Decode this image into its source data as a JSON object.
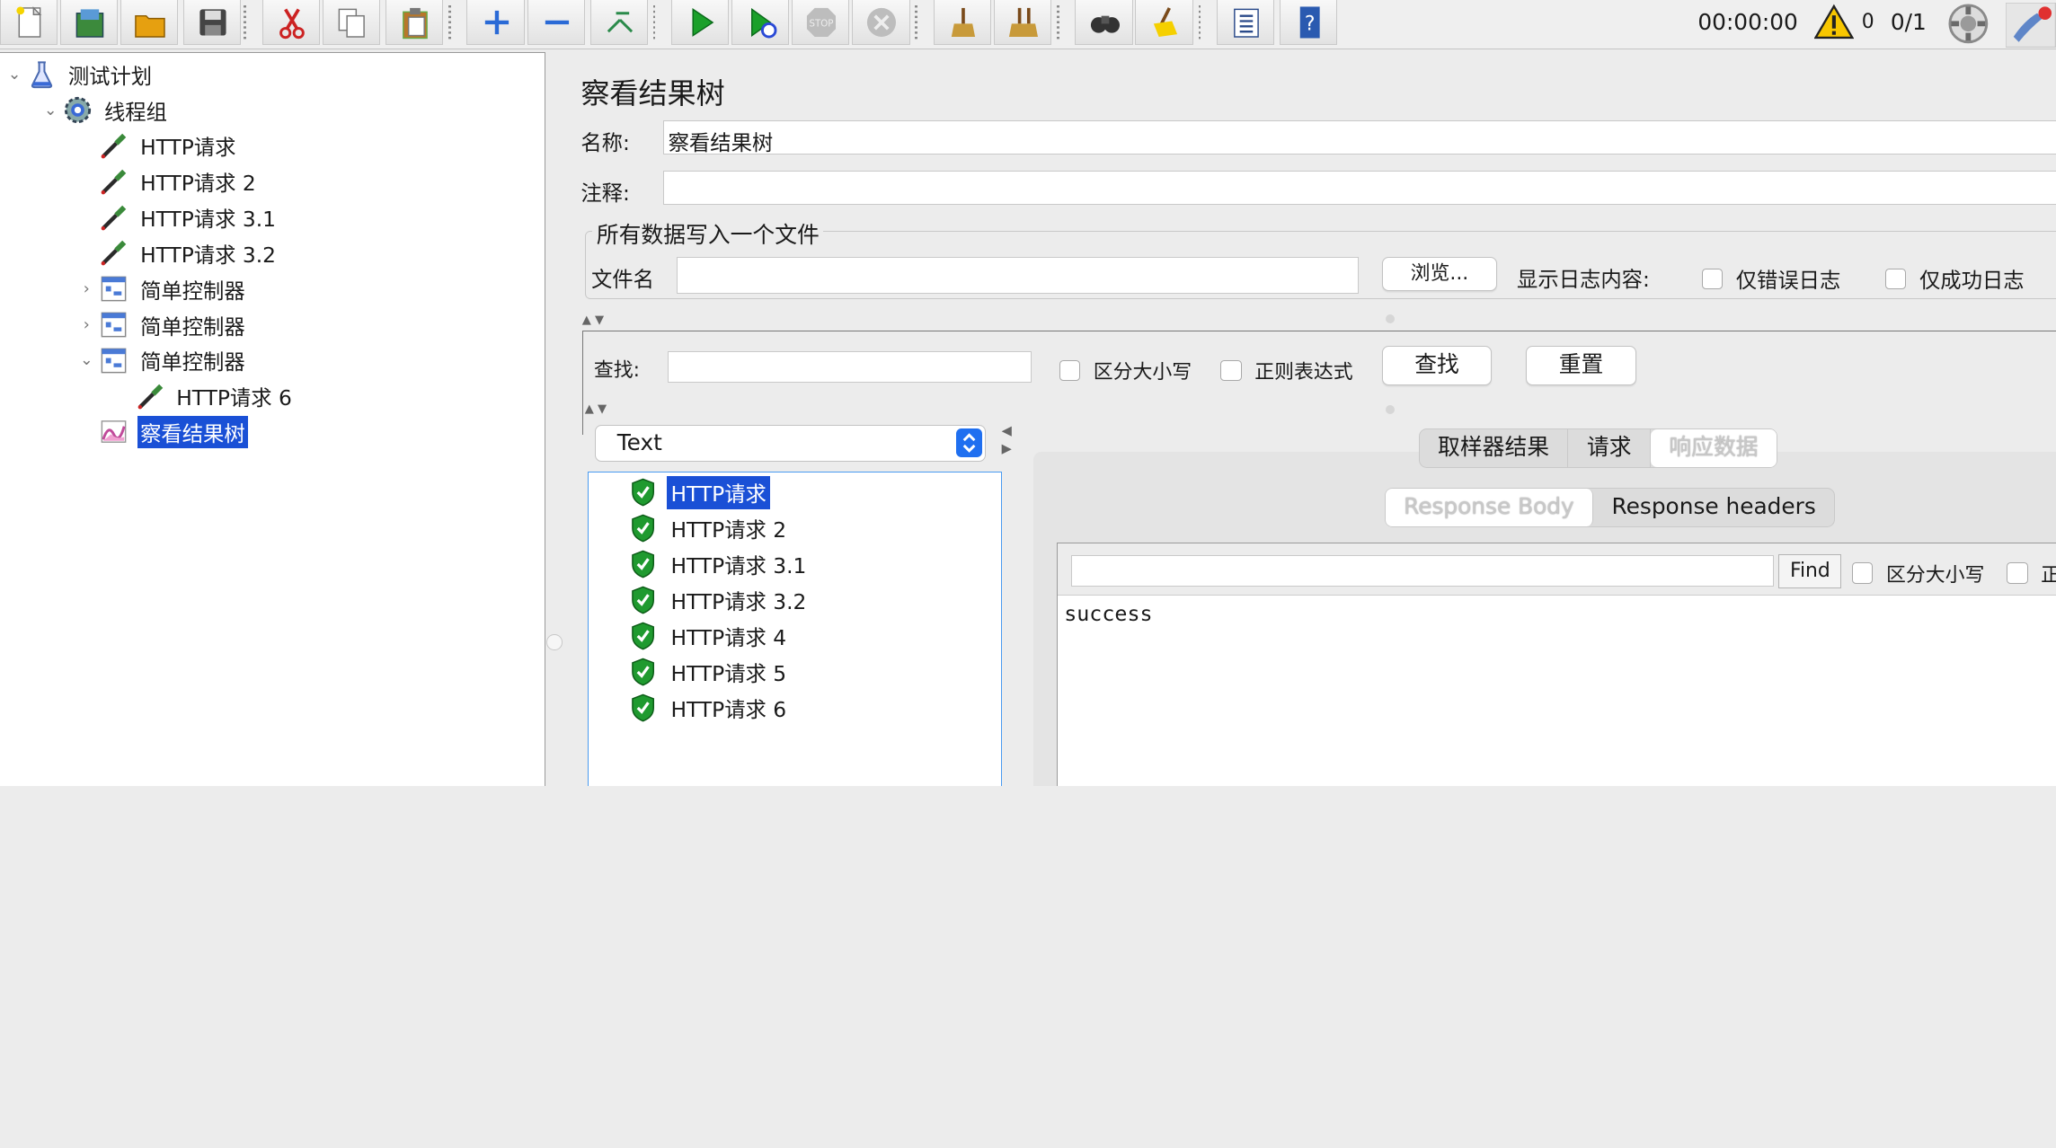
{
  "toolbar": {
    "buttons": [
      "new-icon",
      "templates-icon",
      "open-icon",
      "save-icon",
      "cut-icon",
      "copy-icon",
      "paste-icon",
      "expand-icon",
      "collapse-icon",
      "toggle-icon",
      "start-icon",
      "start-no-pause-icon",
      "stop-icon",
      "shutdown-icon",
      "clear-icon",
      "clear-all-icon",
      "search-icon",
      "reset-search-icon",
      "function-helper-icon",
      "help-icon"
    ],
    "timer": "00:00:00",
    "warning_count": "0",
    "threads": "0/1"
  },
  "tree": {
    "items": [
      {
        "label": "测试计划",
        "icon": "flask-icon",
        "level": 0,
        "expander": "⌄",
        "selected": false
      },
      {
        "label": "线程组",
        "icon": "gear-icon",
        "level": 1,
        "expander": "⌄",
        "selected": false
      },
      {
        "label": "HTTP请求",
        "icon": "pipette-icon",
        "level": 2,
        "expander": "",
        "selected": false
      },
      {
        "label": "HTTP请求 2",
        "icon": "pipette-icon",
        "level": 2,
        "expander": "",
        "selected": false
      },
      {
        "label": "HTTP请求 3.1",
        "icon": "pipette-icon",
        "level": 2,
        "expander": "",
        "selected": false
      },
      {
        "label": "HTTP请求 3.2",
        "icon": "pipette-icon",
        "level": 2,
        "expander": "",
        "selected": false
      },
      {
        "label": "简单控制器",
        "icon": "controller-icon",
        "level": 2,
        "expander": "›",
        "selected": false
      },
      {
        "label": "简单控制器",
        "icon": "controller-icon",
        "level": 2,
        "expander": "›",
        "selected": false
      },
      {
        "label": "简单控制器",
        "icon": "controller-icon",
        "level": 2,
        "expander": "⌄",
        "selected": false
      },
      {
        "label": "HTTP请求 6",
        "icon": "pipette-icon",
        "level": 3,
        "expander": "",
        "selected": false
      },
      {
        "label": "察看结果树",
        "icon": "graph-icon",
        "level": 2,
        "expander": "",
        "selected": true
      }
    ]
  },
  "panel": {
    "title": "察看结果树",
    "name_label": "名称:",
    "name_value": "察看结果树",
    "comment_label": "注释:",
    "comment_value": "",
    "file_group": "所有数据写入一个文件",
    "filename_label": "文件名",
    "filename_value": "",
    "browse_button": "浏览...",
    "log_label": "显示日志内容:",
    "errors_only": "仅错误日志",
    "success_only": "仅成功日志",
    "search_label": "查找:",
    "search_value": "",
    "case_sensitive": "区分大小写",
    "regex": "正则表达式",
    "find_button": "查找",
    "reset_button": "重置"
  },
  "results": {
    "renderer": "Text",
    "items": [
      {
        "label": "HTTP请求",
        "selected": true
      },
      {
        "label": "HTTP请求 2",
        "selected": false
      },
      {
        "label": "HTTP请求 3.1",
        "selected": false
      },
      {
        "label": "HTTP请求 3.2",
        "selected": false
      },
      {
        "label": "HTTP请求 4",
        "selected": false
      },
      {
        "label": "HTTP请求 5",
        "selected": false
      },
      {
        "label": "HTTP请求 6",
        "selected": false
      }
    ]
  },
  "detail": {
    "tabs": [
      "取样器结果",
      "请求",
      "响应数据"
    ],
    "subtabs": [
      "Response Body",
      "Response headers"
    ],
    "find_value": "",
    "find_button": "Find",
    "case_sensitive": "区分大小写",
    "regex_partial": "正",
    "response_text": "success"
  }
}
